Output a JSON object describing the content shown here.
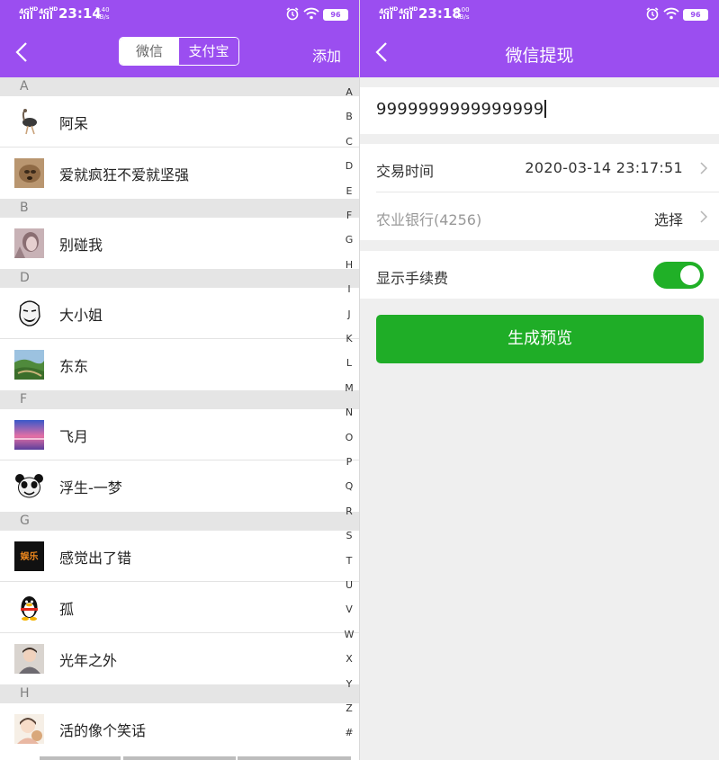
{
  "left": {
    "status": {
      "network": "4G",
      "network_hd": "HD",
      "time": "23:14",
      "speed_value": "3.40",
      "speed_unit": "KB/s",
      "battery": "96"
    },
    "header": {
      "tab_wechat": "微信",
      "tab_alipay": "支付宝",
      "add_label": "添加"
    },
    "sections": [
      {
        "letter": "A",
        "contacts": [
          {
            "name": "阿呆",
            "avatar": "ostrich-avatar"
          },
          {
            "name": "爱就疯狂不爱就坚强",
            "avatar": "dog-avatar"
          }
        ]
      },
      {
        "letter": "B",
        "contacts": [
          {
            "name": "别碰我",
            "avatar": "girl-avatar"
          }
        ]
      },
      {
        "letter": "D",
        "contacts": [
          {
            "name": "大小姐",
            "avatar": "meme-face-avatar"
          },
          {
            "name": "东东",
            "avatar": "landscape-avatar"
          }
        ]
      },
      {
        "letter": "F",
        "contacts": [
          {
            "name": "飞月",
            "avatar": "sunset-avatar"
          },
          {
            "name": "浮生-一梦",
            "avatar": "panda-avatar"
          }
        ]
      },
      {
        "letter": "G",
        "contacts": [
          {
            "name": "感觉出了错",
            "avatar": "logo-avatar",
            "avatar_text": "娱乐"
          },
          {
            "name": "孤",
            "avatar": "penguin-avatar"
          },
          {
            "name": "光年之外",
            "avatar": "child-avatar"
          }
        ]
      },
      {
        "letter": "H",
        "contacts": [
          {
            "name": "活的像个笑话",
            "avatar": "cartoon-avatar"
          }
        ]
      }
    ],
    "index_letters": [
      "A",
      "B",
      "C",
      "D",
      "E",
      "F",
      "G",
      "H",
      "I",
      "J",
      "K",
      "L",
      "M",
      "N",
      "O",
      "P",
      "Q",
      "R",
      "S",
      "T",
      "U",
      "V",
      "W",
      "X",
      "Y",
      "Z",
      "#"
    ]
  },
  "right": {
    "status": {
      "network": "4G",
      "network_hd": "HD",
      "time": "23:18",
      "speed_value": "0.00",
      "speed_unit": "KB/s",
      "battery": "96"
    },
    "header": {
      "title": "微信提现"
    },
    "amount": "9999999999999999",
    "trade_time_label": "交易时间",
    "trade_time_value": "2020-03-14 23:17:51",
    "bank_label": "农业银行(4256)",
    "bank_value": "选择",
    "show_fee_label": "显示手续费",
    "show_fee_on": true,
    "generate_button": "生成预览"
  },
  "colors": {
    "header": "#9b4ef0",
    "green": "#1fad27",
    "section_bg": "#e5e5e5"
  }
}
